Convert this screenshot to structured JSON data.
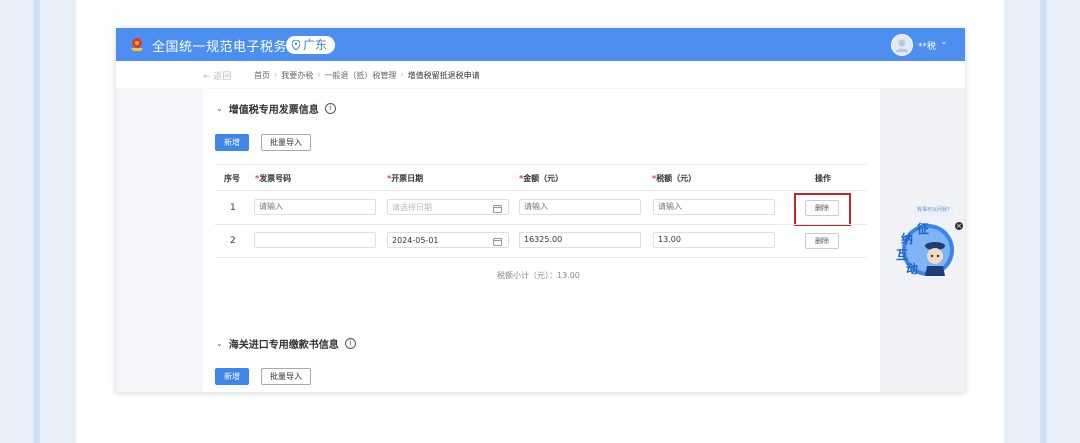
{
  "header": {
    "site_title": "全国统一规范电子税务局",
    "region": "广东",
    "user_name": "**税",
    "user_caret": "⌄"
  },
  "breadcrumb": {
    "back": "← 返回",
    "items": [
      "首页",
      "我要办税",
      "一般退（抵）税管理",
      "增值税留抵退税申请"
    ],
    "separator": "›"
  },
  "section_vat": {
    "title": "增值税专用发票信息",
    "add_button": "新增",
    "import_button": "批量导入",
    "table": {
      "columns": {
        "seq": "序号",
        "invoice_no": "发票号码",
        "issue_date": "开票日期",
        "amount": "金额（元）",
        "tax": "税额（元）",
        "action": "操作"
      },
      "required_mark": "*",
      "rows": [
        {
          "seq": "1",
          "invoice_no": "",
          "invoice_no_placeholder": "请输入",
          "issue_date": "",
          "issue_date_placeholder": "请选择日期",
          "amount": "",
          "amount_placeholder": "请输入",
          "tax": "",
          "tax_placeholder": "请输入",
          "delete": "删除"
        },
        {
          "seq": "2",
          "invoice_no": "",
          "invoice_no_placeholder": "",
          "issue_date": "2024-05-01",
          "issue_date_placeholder": "",
          "amount": "16325.00",
          "amount_placeholder": "",
          "tax": "13.00",
          "tax_placeholder": "",
          "delete": "删除"
        }
      ]
    },
    "subtotal": "税额小计（元）：13.00"
  },
  "section_customs": {
    "title": "海关进口专用缴款书信息",
    "add_button": "新增",
    "import_button": "批量导入"
  },
  "assistant": {
    "bubble": "有事可以问我?",
    "chars": [
      "征",
      "纳",
      "互",
      "动"
    ],
    "close": "×"
  },
  "colors": {
    "topbar": "#4c8ff0",
    "primary": "#3f86ea",
    "highlight": "#c0282d",
    "required": "#e03c3c"
  }
}
